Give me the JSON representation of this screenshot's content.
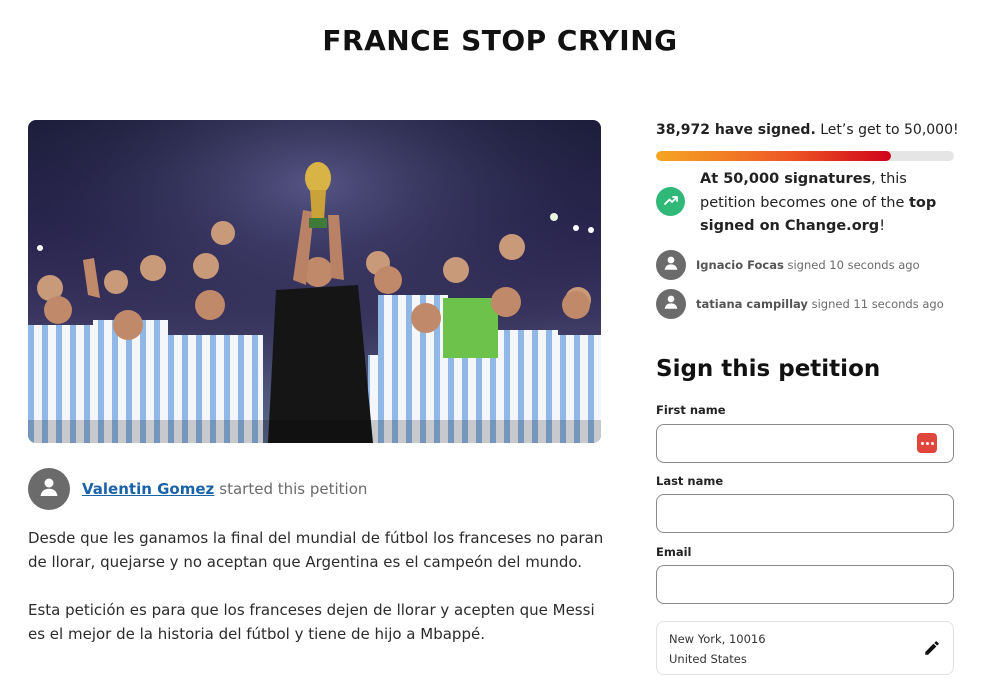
{
  "page": {
    "title": "FRANCE STOP CRYING"
  },
  "author": {
    "name": "Valentin Gomez",
    "action": "started this petition"
  },
  "description": [
    "Desde que les ganamos la final del mundial de fútbol los franceses no paran de llorar, quejarse y no aceptan que Argentina es el campeón del mundo.",
    "Esta petición es para que los franceses dejen de llorar y acepten que Messi es el mejor de la historia del fútbol y tiene de hijo a Mbappé."
  ],
  "signatures": {
    "count_text": "38,972 have signed.",
    "goal_text": "Let’s get to 50,000!",
    "progress": 0.79,
    "milestone": {
      "bold1": "At 50,000 signatures",
      "text1": ", this petition becomes one of the ",
      "bold2": "top signed on Change.org",
      "text2": "!"
    },
    "recent": [
      {
        "name": "Ignacio Focas",
        "action": "signed 10 seconds ago"
      },
      {
        "name": "tatiana campillay",
        "action": "signed 11 seconds ago"
      }
    ]
  },
  "form": {
    "heading": "Sign this petition",
    "first_name_label": "First name",
    "last_name_label": "Last name",
    "email_label": "Email",
    "location_line1": "New York, 10016",
    "location_line2": "United States"
  },
  "colors": {
    "link": "#1a63a8",
    "progress_start": "#f5a623",
    "progress_end": "#d0021b",
    "milestone_icon": "#2fb877",
    "password_icon": "#e0463c"
  },
  "icons": {
    "avatar": "person-icon",
    "milestone": "trending-up-icon",
    "field": "password-manager-icon",
    "location": "pencil-icon"
  }
}
